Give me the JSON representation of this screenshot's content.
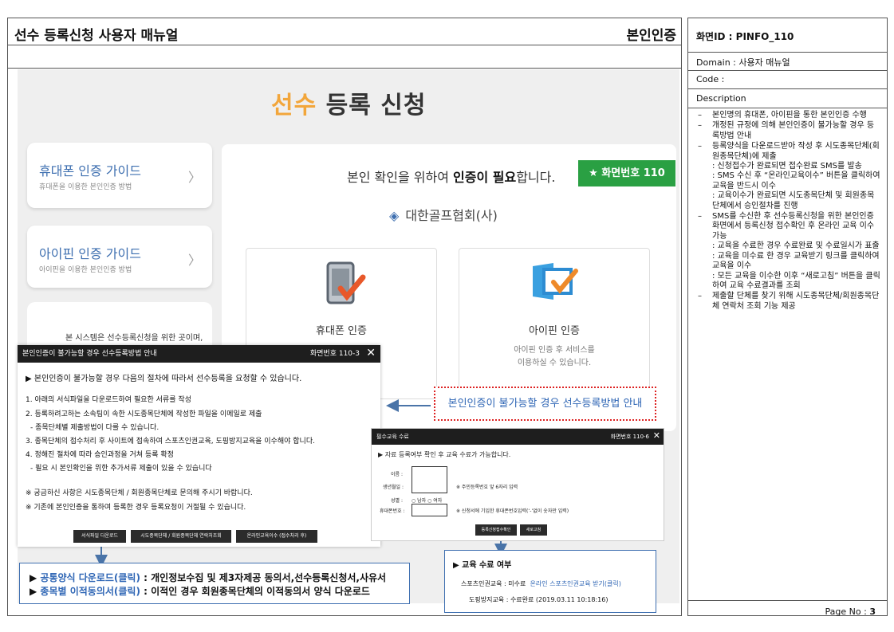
{
  "doc": {
    "title": "선수 등록신청 사용자 매뉴얼",
    "section": "본인인증"
  },
  "screen": {
    "title_hl": "선수",
    "title_rest": " 등록 신청",
    "guides": [
      {
        "title": "휴대폰 인증 가이드",
        "sub": "휴대폰을 이용한 본인인증 방법"
      },
      {
        "title": "아이핀 인증 가이드",
        "sub": "아이핀을 이용한 본인인증 방법"
      }
    ],
    "system_text": "본 시스템은 선수등록신청을 위한 곳이며,",
    "need_pre": "본인 확인을 위하여 ",
    "need_bold": "인증이 필요",
    "need_post": "합니다.",
    "screen_badge": "★  화면번호 110",
    "org": "대한골프협회(사)",
    "phone_auth": {
      "title": "휴대폰 인증"
    },
    "ipin_auth": {
      "title": "아이핀 인증",
      "desc1": "아이핀 인증 후 서비스를",
      "desc2": "이용하실 수 있습니다."
    },
    "red_box_text": "본인인증이 불가능할 경우 선수등록방법 안내"
  },
  "popup1": {
    "title": "본인인증이 불가능할 경우 선수등록방법 안내",
    "screen_no": "화면번호 110-3",
    "intro": "▶ 본인인증이 불가능할 경우 다음의 절차에 따라서 선수등록을 요청할 수 있습니다.",
    "lines": [
      "1. 아래의 서식파일을 다운로드하여 필요한 서류를 작성",
      "2. 등록하려고하는 소속팀이 속한 시도종목단체에 작성한 파일을 이메일로 제출",
      "  - 종목단체별 제출방법이 다를 수 있습니다.",
      "3. 종목단체의 접수처리 후 사이트에 접속하여 스포츠인권교육, 도핑방지교육을 이수해야 합니다.",
      "4. 정해진 절차에 따라 승인과정을 거쳐 등록 확정",
      "  - 필요 시 본인확인을 위한 추가서류 제출이 있을 수 있습니다",
      "※ 궁금하신 사항은 시도종목단체 / 회원종목단체로 문의해 주시기 바랍니다.",
      "※ 기존에 본인인증을 통하여 등록한 경우 등록요청이 거절될 수 있습니다."
    ],
    "buttons": [
      "서식파일 다운로드",
      "시도종목단체 / 회원종목단체 연락처조회",
      "온라인교육이수 (접수처리 후)"
    ]
  },
  "popup2": {
    "title": "필수교육 수료",
    "screen_no": "화면번호 110-6",
    "intro": "▶ 자료 등록여부 확인 후 교육 수료가 가능합니다.",
    "name_label": "이름 :",
    "birth_label": "생년월일 :",
    "birth_hint": "※ 주민등록번호 앞 6자리 입력",
    "gender_label": "성별 :",
    "gender_opts": "○ 남자   ○ 여자",
    "phone_label": "휴대폰번호 :",
    "phone_hint": "※ 신청서에 기입한 휴대폰번호입력(‘-’없이 숫자만 입력)",
    "btn_check": "등록신청접수확인",
    "btn_refresh": "새로고침"
  },
  "edu": {
    "title": "▶ 교육 수료 여부",
    "sports_label": "스포츠인권교육 : 미수료",
    "sports_link": "온라인 스포츠인권교육 받기(클릭)",
    "doping": "도핑방지교육 : 수료완료 (2019.03.11 10:18:16)"
  },
  "download": {
    "row1_arrow": "▶ ",
    "row1_link": "공통양식 다운로드(클릭)",
    "row1_text": " : 개인정보수집 및 제3자제공 동의서,선수등록신청서,사유서",
    "row2_arrow": "▶ ",
    "row2_link": "종목별 이적동의서(클릭)",
    "row2_text": " : 이적인 경우 회원종목단체의 이적동의서 양식 다운로드"
  },
  "side": {
    "screen_id": "화면ID : PINFO_110",
    "domain": "Domain : 사용자 매뉴얼",
    "code": "Code :",
    "description_label": "Description",
    "items": [
      "본인명의 휴대폰, 아이핀을 통한 본인인증 수행",
      "개정된 규정에 의해 본인인증이 불가능할 경우 등록방법 안내",
      "등록양식을 다운로드받아 작성 후 시도종목단체(회원종목단체)에 제출\n: 신청접수가 완료되면 접수완료 SMS를 발송\n: SMS 수신 후 “온라인교육이수” 버튼을 클릭하여 교육을 반드시 이수\n: 교육이수가 완료되면 시도종목단체 및 회원종목단체에서 승인절차를 진행",
      "SMS를 수신한 후 선수등록신청을 위한 본인인증 화면에서 등록신청 접수확인 후 온라인 교육 이수 가능\n: 교육을 수료한 경우 수료완료 및 수료일시가 표출\n: 교육을 미수료 한 경우 교육받기 링크를 클릭하여 교육을 이수\n: 모든 교육을 이수한 이후 “새로고침” 버튼을 클릭하여 교육 수료결과를 조회",
      "제출할 단체를 찾기 위해 시도종목단체/회원종목단체 연락처 조회 기능 제공"
    ],
    "page_label": "Page No : ",
    "page_no": "3"
  }
}
